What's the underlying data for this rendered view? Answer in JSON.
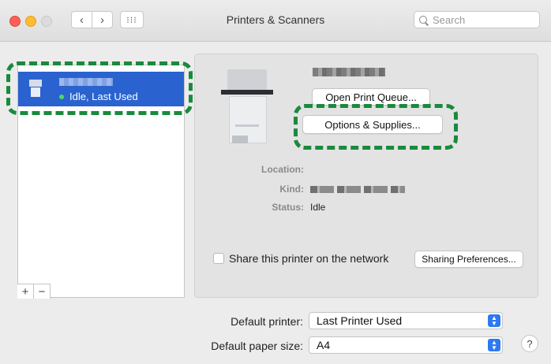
{
  "window": {
    "title": "Printers & Scanners"
  },
  "toolbar": {
    "search_placeholder": "Search"
  },
  "printer_list": {
    "items": [
      {
        "status": "Idle, Last Used"
      }
    ],
    "add_label": "+",
    "remove_label": "−"
  },
  "detail": {
    "open_queue_label": "Open Print Queue...",
    "options_label": "Options & Supplies...",
    "location_label": "Location:",
    "kind_label": "Kind:",
    "status_label": "Status:",
    "status_value": "Idle",
    "share_label": "Share this printer on the network",
    "sharing_prefs_label": "Sharing Preferences..."
  },
  "defaults": {
    "default_printer_label": "Default printer:",
    "default_printer_value": "Last Printer Used",
    "paper_size_label": "Default paper size:",
    "paper_size_value": "A4"
  },
  "help_label": "?",
  "colors": {
    "accent": "#2a63cf",
    "highlight": "#1a8a3d",
    "status_dot": "#4cd964"
  }
}
